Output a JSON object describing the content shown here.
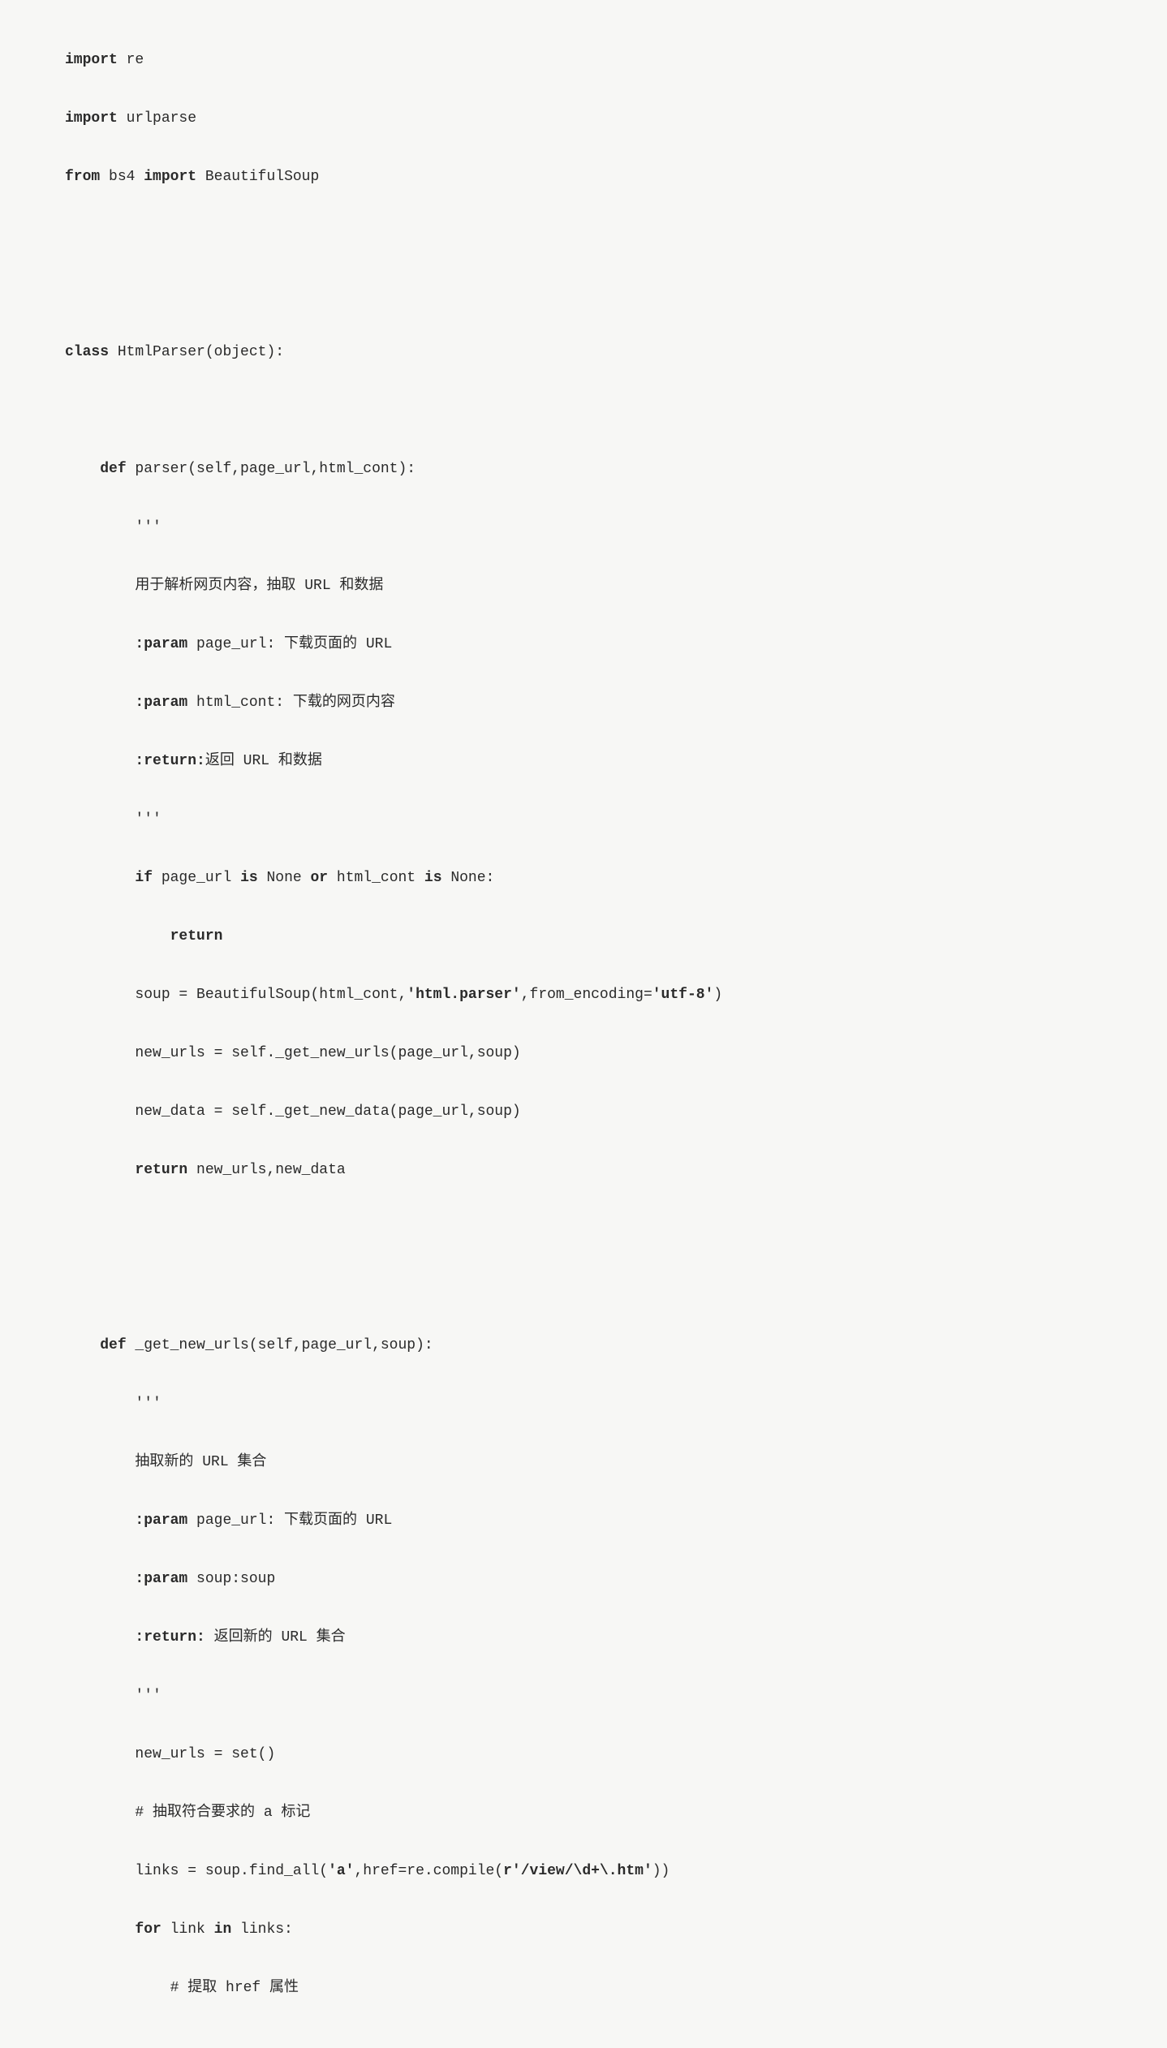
{
  "code": {
    "line1_kw1": "import",
    "line1_text": " re",
    "line2_kw1": "import",
    "line2_text": " urlparse",
    "line3_kw1": "from",
    "line3_text1": " bs4 ",
    "line3_kw2": "import",
    "line3_text2": " BeautifulSoup",
    "line4_kw1": "class",
    "line4_text": " HtmlParser(object):",
    "line5_kw1": "def",
    "line5_text": " parser(self,page_url,html_cont):",
    "line6_text": "'''",
    "line7_text": "用于解析网页内容，抽取 URL 和数据",
    "line8_kw1": ":param",
    "line8_text": " page_url: 下载页面的 URL",
    "line9_kw1": ":param",
    "line9_text": " html_cont: 下载的网页内容",
    "line10_kw1": ":return:",
    "line10_text": "返回 URL 和数据",
    "line11_text": "'''",
    "line12_kw1": "if",
    "line12_text1": " page_url ",
    "line12_kw2": "is",
    "line12_text2": " None ",
    "line12_kw3": "or",
    "line12_text3": " html_cont ",
    "line12_kw4": "is",
    "line12_text4": " None:",
    "line13_kw1": "return",
    "line14_text1": "soup = BeautifulSoup(html_cont,",
    "line14_bold1": "'html.parser'",
    "line14_text2": ",from_encoding=",
    "line14_bold2": "'utf-8'",
    "line14_text3": ")",
    "line15_text": "new_urls = self._get_new_urls(page_url,soup)",
    "line16_text": "new_data = self._get_new_data(page_url,soup)",
    "line17_kw1": "return",
    "line17_text": " new_urls,new_data",
    "line18_kw1": "def",
    "line18_text": " _get_new_urls(self,page_url,soup):",
    "line19_text": "'''",
    "line20_text": "抽取新的 URL 集合",
    "line21_kw1": ":param",
    "line21_text": " page_url: 下载页面的 URL",
    "line22_kw1": ":param",
    "line22_text": " soup:soup",
    "line23_kw1": ":return:",
    "line23_text": " 返回新的 URL 集合",
    "line24_text": "'''",
    "line25_text": "new_urls = set()",
    "line26_text": "# 抽取符合要求的 a 标记",
    "line27_text1": "links = soup.find_all(",
    "line27_bold1": "'a'",
    "line27_text2": ",href=re.compile(",
    "line27_bold2": "r'/view/\\d+\\.htm'",
    "line27_text3": "))",
    "line28_kw1": "for",
    "line28_text1": " link ",
    "line28_kw2": "in",
    "line28_text2": " links:",
    "line29_text": "# 提取 href 属性"
  }
}
